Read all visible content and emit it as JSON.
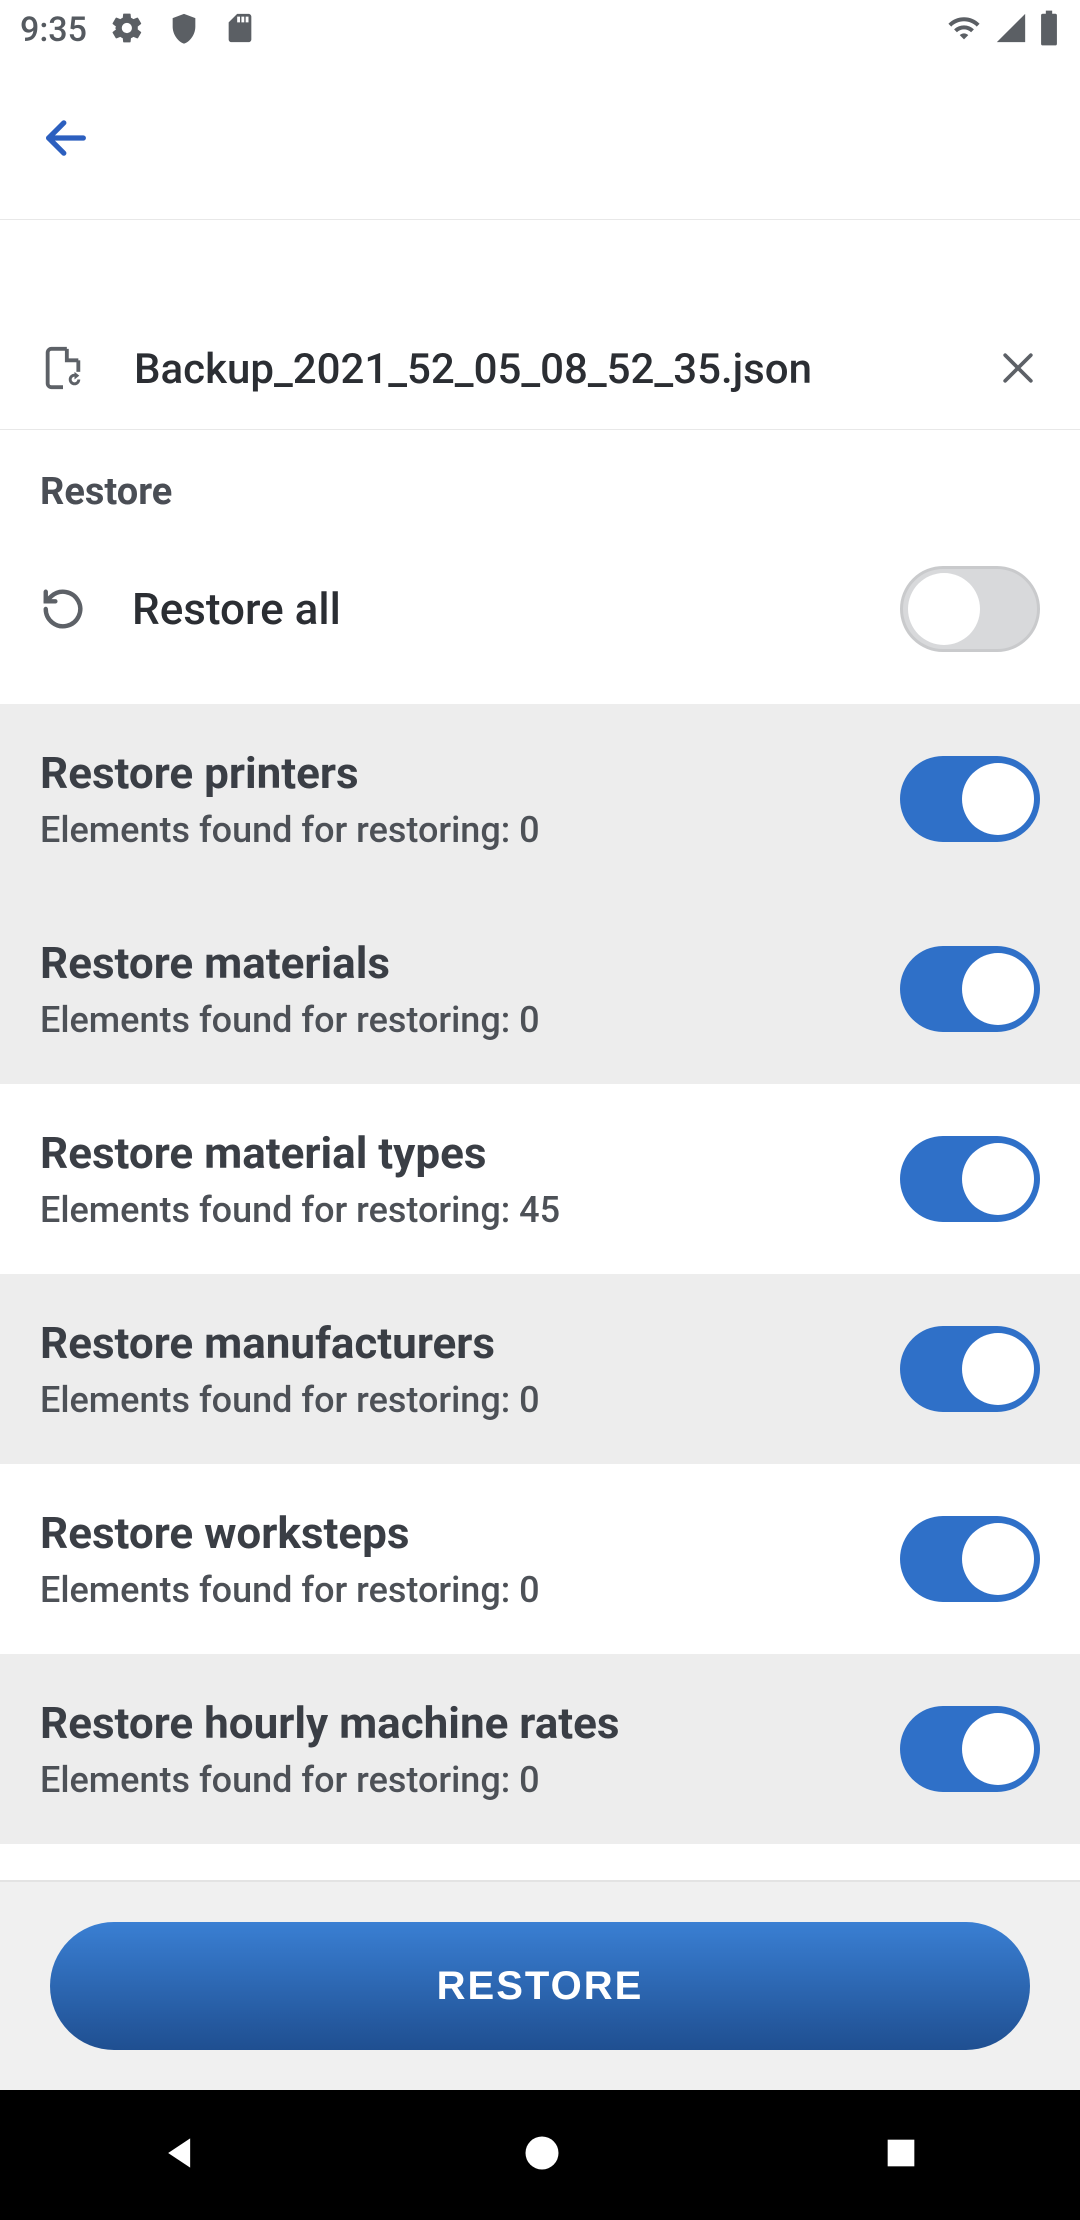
{
  "status": {
    "time": "9:35"
  },
  "file": {
    "name": "Backup_2021_52_05_08_52_35.json"
  },
  "section": {
    "header": "Restore"
  },
  "restore_all": {
    "label": "Restore all",
    "on": false
  },
  "options": [
    {
      "title": "Restore printers",
      "sub": "Elements found for restoring: 0",
      "on": true,
      "alt": true
    },
    {
      "title": "Restore materials",
      "sub": "Elements found for restoring: 0",
      "on": true,
      "alt": true
    },
    {
      "title": "Restore material types",
      "sub": "Elements found for restoring: 45",
      "on": true,
      "alt": false
    },
    {
      "title": "Restore manufacturers",
      "sub": "Elements found for restoring: 0",
      "on": true,
      "alt": true
    },
    {
      "title": "Restore worksteps",
      "sub": "Elements found for restoring: 0",
      "on": true,
      "alt": false
    },
    {
      "title": "Restore hourly machine rates",
      "sub": "Elements found for restoring: 0",
      "on": true,
      "alt": true
    }
  ],
  "footer": {
    "button": "RESTORE"
  }
}
